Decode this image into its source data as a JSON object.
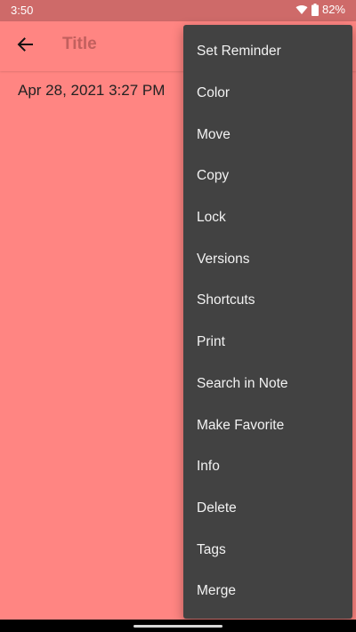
{
  "status_bar": {
    "time": "3:50",
    "battery": "82%",
    "icons": [
      "wifi-icon",
      "battery-icon"
    ]
  },
  "toolbar": {
    "back_icon": "arrow-left-icon",
    "title": "Title"
  },
  "note": {
    "date": "Apr 28, 2021 3:27 PM"
  },
  "menu": {
    "items": [
      {
        "label": "Set Reminder"
      },
      {
        "label": "Color"
      },
      {
        "label": "Move"
      },
      {
        "label": "Copy"
      },
      {
        "label": "Lock"
      },
      {
        "label": "Versions"
      },
      {
        "label": "Shortcuts"
      },
      {
        "label": "Print"
      },
      {
        "label": "Search in Note"
      },
      {
        "label": "Make Favorite"
      },
      {
        "label": "Info"
      },
      {
        "label": "Delete"
      },
      {
        "label": "Tags"
      },
      {
        "label": "Merge"
      }
    ]
  },
  "colors": {
    "note_background": "#ff8582",
    "status_bar": "#ce6a69",
    "menu_background": "#424242",
    "menu_text": "#f2f2f2"
  }
}
